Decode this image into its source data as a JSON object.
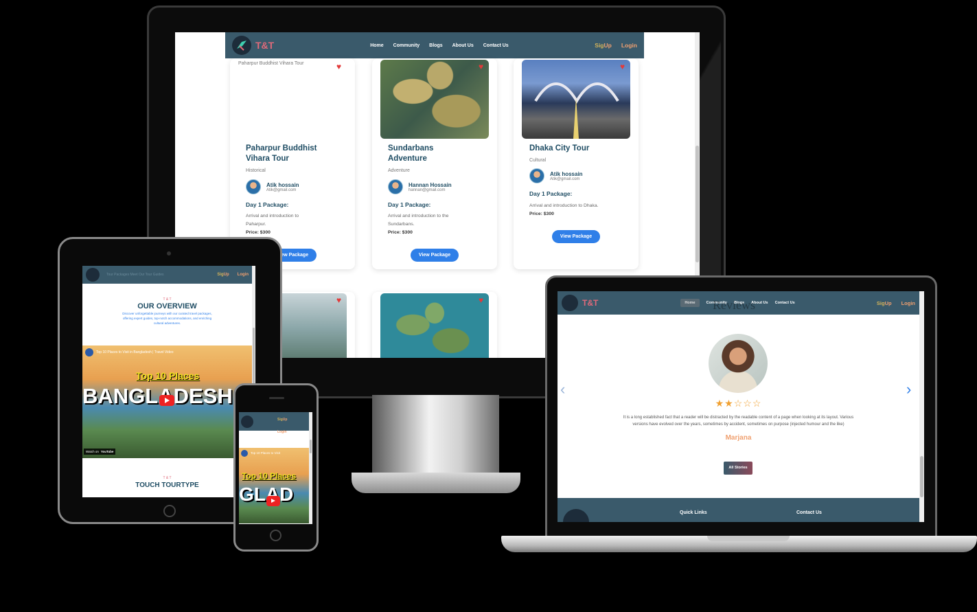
{
  "brand": {
    "logo_text": "T&T"
  },
  "nav": {
    "home": "Home",
    "community": "Community",
    "blogs": "Blogs",
    "about": "About Us",
    "contact": "Contact Us",
    "signup_a": "Sig",
    "signup_b": "Up",
    "login": "Login"
  },
  "monitor": {
    "cards": [
      {
        "img_alt": "Paharpur Buddhist Vihara Tour",
        "title_1": "Paharpur Buddhist",
        "title_2": "Vihara Tour",
        "category": "Historical",
        "author_name": "Atik hossain",
        "author_email": "Atik@gmail.com",
        "package_label": "Day 1 Package:",
        "desc_1": "Arrival and introduction to",
        "desc_2": "Paharpur.",
        "price": "Price: $300",
        "button": "View Package"
      },
      {
        "title_1": "Sundarbans",
        "title_2": "Adventure",
        "category": "Adventure",
        "author_name": "Hannan Hossain",
        "author_email": "hannan@gmail.com",
        "package_label": "Day 1 Package:",
        "desc_1": "Arrival and introduction to the",
        "desc_2": "Sundarbans.",
        "price": "Price: $300",
        "button": "View Package"
      },
      {
        "title_1": "Dhaka City Tour",
        "category": "Cultural",
        "author_name": "Atik hossain",
        "author_email": "Atik@gmail.com",
        "package_label": "Day 1 Package:",
        "desc_1": "Arrival and introduction to Dhaka.",
        "price": "Price: $300",
        "button": "View Package"
      }
    ]
  },
  "tablet": {
    "nav_faint": "Tour Packages   Meet Our Tour Guides",
    "overview_kicker": "T & T",
    "overview_title": "OUR OVERVIEW",
    "overview_text_1": "Discover unforgettable journeys with our curated travel packages,",
    "overview_text_2": "offering expert guides, top-notch accommodations, and enriching",
    "overview_text_3": "cultural adventures.",
    "video_title": "Top 10 Places to Visit in Bangladesh | Travel Video",
    "video_big_1": "Top 10 Places",
    "video_big_2": "BANGLADESH",
    "watch_on": "Watch on",
    "youtube": "YouTube",
    "tour_kicker": "T & T",
    "tour_title": "TOUCH TOURTYPE"
  },
  "phone": {
    "video_title": "Top 10 Places to Visit",
    "video_big_1": "Top 10 Places",
    "video_big_2": "GLAD"
  },
  "laptop": {
    "ghost_title": "Reviews",
    "stars": "★★☆☆☆",
    "review_1": "It is a long established fact that a reader will be distracted by the readable content of a page when looking at its layout. Various",
    "review_2": "versions have evolved over the years, sometimes by accident, sometimes on purpose (injected humour and the like)",
    "reviewer": "Marjana",
    "all_stories": "All Stories",
    "footer_quick": "Quick Links",
    "footer_contact": "Contact Us"
  },
  "colors": {
    "nav": "#3a5a6b",
    "button": "#2f7fe8",
    "title": "#1e4c63",
    "accent": "#f0a070",
    "star": "#f0a030"
  }
}
